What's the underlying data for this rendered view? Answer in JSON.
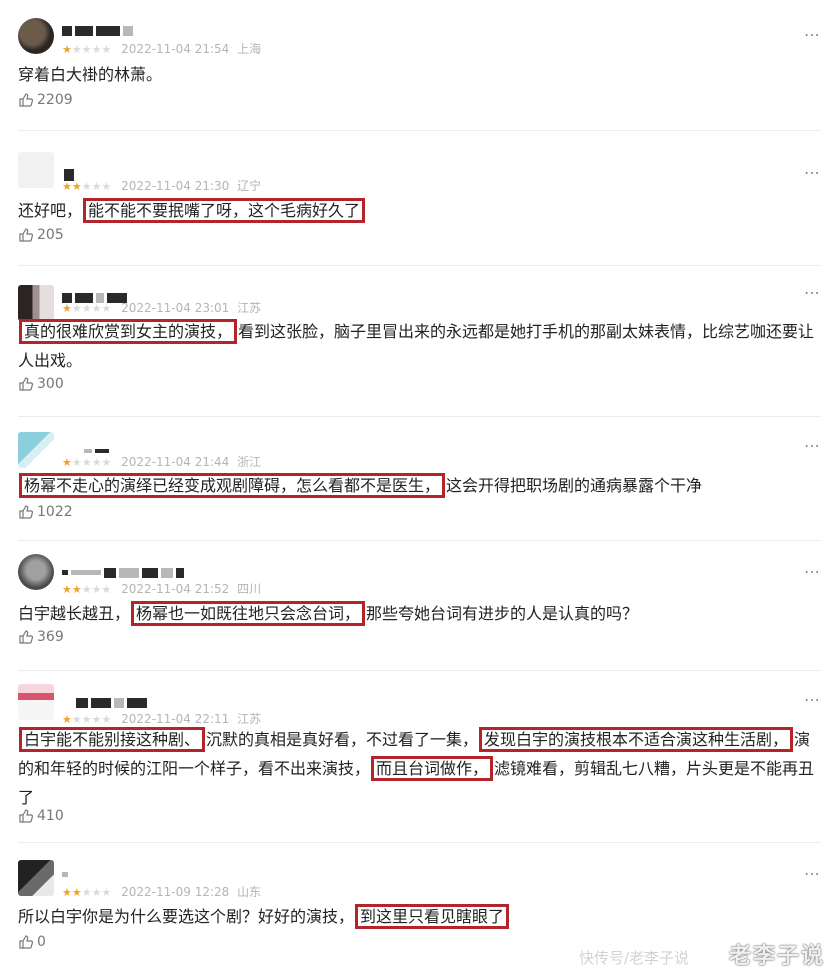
{
  "comments": [
    {
      "username_mosaic": "",
      "stars_on": 1,
      "stars_total": 5,
      "time": "2022-11-04 21:54",
      "location": "上海",
      "text_parts": [
        {
          "t": "穿着白大褂的林萧。",
          "hl": false
        }
      ],
      "likes": "2209"
    },
    {
      "stars_on": 2,
      "stars_total": 5,
      "time": "2022-11-04 21:30",
      "location": "辽宁",
      "text_parts": [
        {
          "t": "还好吧，",
          "hl": false
        },
        {
          "t": "能不能不要抿嘴了呀，这个毛病好久了",
          "hl": true
        }
      ],
      "likes": "205"
    },
    {
      "stars_on": 1,
      "stars_total": 5,
      "time": "2022-11-04 23:01",
      "location": "江苏",
      "text_parts": [
        {
          "t": "真的很难欣赏到女主的演技，",
          "hl": true
        },
        {
          "t": "看到这张脸，脑子里冒出来的永远都是她打手机的那副太妹表情，比综艺咖还要让人出戏。",
          "hl": false
        }
      ],
      "likes": "300"
    },
    {
      "stars_on": 1,
      "stars_total": 5,
      "time": "2022-11-04 21:44",
      "location": "浙江",
      "text_parts": [
        {
          "t": "杨幂不走心的演绎已经变成观剧障碍，怎么看都不是医生，",
          "hl": true
        },
        {
          "t": "这会开得把职场剧的通病暴露个干净",
          "hl": false
        }
      ],
      "likes": "1022"
    },
    {
      "stars_on": 2,
      "stars_total": 5,
      "time": "2022-11-04 21:52",
      "location": "四川",
      "text_parts": [
        {
          "t": "白宇越长越丑，",
          "hl": false
        },
        {
          "t": "杨幂也一如既往地只会念台词，",
          "hl": true
        },
        {
          "t": "那些夸她台词有进步的人是认真的吗？",
          "hl": false
        }
      ],
      "likes": "369"
    },
    {
      "stars_on": 1,
      "stars_total": 5,
      "time": "2022-11-04 22:11",
      "location": "江苏",
      "text_parts": [
        {
          "t": "白宇能不能别接这种剧、",
          "hl": true
        },
        {
          "t": "沉默的真相是真好看，不过看了一集，",
          "hl": false
        },
        {
          "t": "发现白宇的演技根本不适合演这种生活剧，",
          "hl": true
        },
        {
          "t": "演的和年轻的时候的江阳一个样子，看不出来演技，",
          "hl": false
        },
        {
          "t": "而且台词做作，",
          "hl": true
        },
        {
          "t": "滤镜难看，剪辑乱七八糟，片头更是不能再丑了",
          "hl": false
        }
      ],
      "likes": "410"
    },
    {
      "stars_on": 2,
      "stars_total": 5,
      "time": "2022-11-09 12:28",
      "location": "山东",
      "text_parts": [
        {
          "t": "所以白宇你是为什么要选这个剧？好好的演技，",
          "hl": false
        },
        {
          "t": "到这里只看见瞎眼了",
          "hl": true
        }
      ],
      "likes": "0"
    }
  ],
  "more_icon": "⋯",
  "watermark": "老李子说",
  "watermark_small": "快传号/老李子说",
  "colors": {
    "star_on": "#f0a32c",
    "star_off": "#dadada",
    "highlight_border": "#b3252b"
  }
}
